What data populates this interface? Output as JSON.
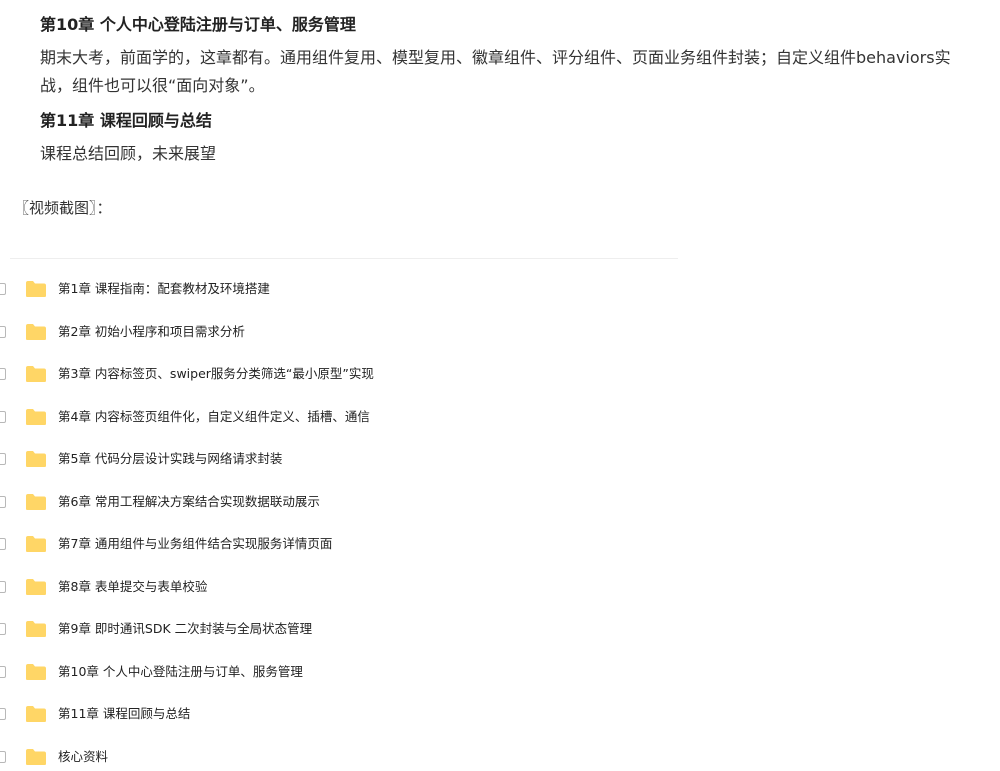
{
  "article": {
    "sections": [
      {
        "title": "第10章 个人中心登陆注册与订单、服务管理",
        "description": "期末大考，前面学的，这章都有。通用组件复用、模型复用、徽章组件、评分组件、页面业务组件封装；自定义组件behaviors实战，组件也可以很“面向对象”。"
      },
      {
        "title": "第11章 课程回顾与总结",
        "description": "课程总结回顾，未来展望"
      }
    ],
    "screenshot_label": "〖视频截图〗："
  },
  "explorer": {
    "folder_icon": "folder-icon",
    "folder_color": "#FFD666",
    "folders": [
      "第1章 课程指南：配套教材及环境搭建",
      "第2章 初始小程序和项目需求分析",
      "第3章 内容标签页、swiper服务分类筛选“最小原型”实现",
      "第4章 内容标签页组件化，自定义组件定义、插槽、通信",
      "第5章 代码分层设计实践与网络请求封装",
      "第6章 常用工程解决方案结合实现数据联动展示",
      "第7章 通用组件与业务组件结合实现服务详情页面",
      "第8章 表单提交与表单校验",
      "第9章 即时通讯SDK 二次封装与全局状态管理",
      "第10章 个人中心登陆注册与订单、服务管理",
      "第11章 课程回顾与总结",
      "核心资料"
    ]
  }
}
